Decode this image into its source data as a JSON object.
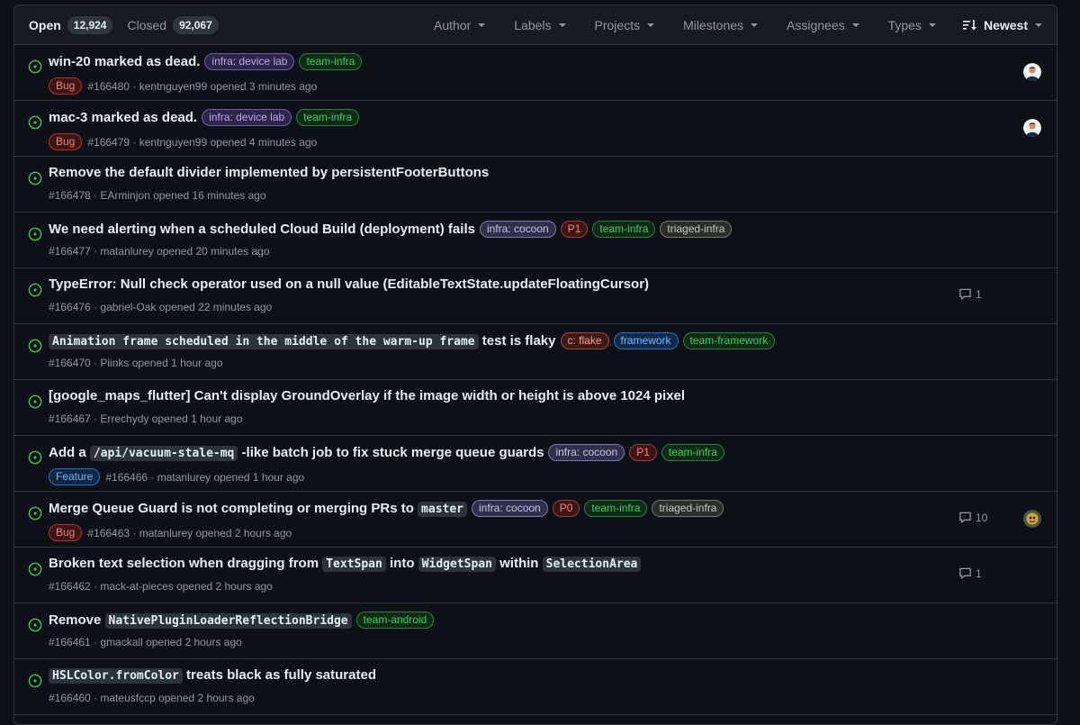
{
  "tabs": {
    "open_label": "Open",
    "open_count": "12,924",
    "closed_label": "Closed",
    "closed_count": "92,067"
  },
  "filters": [
    "Author",
    "Labels",
    "Projects",
    "Milestones",
    "Assignees",
    "Types"
  ],
  "sort_label": "Newest",
  "label_colors": {
    "infra: device lab": {
      "fg": "#b7a7f2",
      "bg": "#2e2647",
      "bd": "#6e5bb8"
    },
    "infra: cocoon": {
      "fg": "#c9c3ee",
      "bg": "#30304a",
      "bd": "#7c77b0"
    },
    "team-infra": {
      "fg": "#3fd15c",
      "bg": "#0f2a17",
      "bd": "#238636"
    },
    "team-framework": {
      "fg": "#3fd15c",
      "bg": "#0f2a17",
      "bd": "#238636"
    },
    "team-android": {
      "fg": "#3fd15c",
      "bg": "#0f2a17",
      "bd": "#238636"
    },
    "triaged-infra": {
      "fg": "#c2c8c2",
      "bg": "#2a2f2a",
      "bd": "#6f776f"
    },
    "P1": {
      "fg": "#ff8177",
      "bg": "#3b1615",
      "bd": "#a23a33"
    },
    "P0": {
      "fg": "#ff8177",
      "bg": "#3b1615",
      "bd": "#a23a33"
    },
    "Bug": {
      "fg": "#ff7b72",
      "bg": "#3b1615",
      "bd": "#b3322b"
    },
    "c: flake": {
      "fg": "#ff9e8c",
      "bg": "#3d1a15",
      "bd": "#a8483a"
    },
    "framework": {
      "fg": "#79b8ff",
      "bg": "#102a4a",
      "bd": "#2f6fbf"
    },
    "Feature": {
      "fg": "#6cb6ff",
      "bg": "#0f2744",
      "bd": "#2f6fbf"
    }
  },
  "issues": [
    {
      "title_parts": [
        {
          "t": "win-20 marked as dead."
        }
      ],
      "labels": [
        "infra: device lab",
        "team-infra"
      ],
      "type_label": "Bug",
      "number": "#166480",
      "byline": "kentnguyen99 opened 3 minutes ago",
      "comments": "",
      "avatar": "person"
    },
    {
      "title_parts": [
        {
          "t": "mac-3 marked as dead."
        }
      ],
      "labels": [
        "infra: device lab",
        "team-infra"
      ],
      "type_label": "Bug",
      "number": "#166479",
      "byline": "kentnguyen99 opened 4 minutes ago",
      "comments": "",
      "avatar": "person"
    },
    {
      "title_parts": [
        {
          "t": "Remove the default divider implemented by persistentFooterButtons"
        }
      ],
      "labels": [],
      "type_label": "",
      "number": "#166478",
      "byline": "EArminjon opened 16 minutes ago",
      "comments": "",
      "avatar": ""
    },
    {
      "title_parts": [
        {
          "t": "We need alerting when a scheduled Cloud Build (deployment) fails"
        }
      ],
      "labels": [
        "infra: cocoon",
        "P1",
        "team-infra",
        "triaged-infra"
      ],
      "type_label": "",
      "number": "#166477",
      "byline": "matanlurey opened 20 minutes ago",
      "comments": "",
      "avatar": ""
    },
    {
      "title_parts": [
        {
          "t": "TypeError: Null check operator used on a null value (EditableTextState.updateFloatingCursor)"
        }
      ],
      "labels": [],
      "type_label": "",
      "number": "#166476",
      "byline": "gabriel-Oak opened 22 minutes ago",
      "comments": "1",
      "avatar": ""
    },
    {
      "title_parts": [
        {
          "t": "Animation frame scheduled in the middle of the warm-up frame",
          "code": true
        },
        {
          "t": " test is flaky"
        }
      ],
      "labels": [
        "c: flake",
        "framework",
        "team-framework"
      ],
      "type_label": "",
      "number": "#166470",
      "byline": "Piinks opened 1 hour ago",
      "comments": "",
      "avatar": ""
    },
    {
      "title_parts": [
        {
          "t": "[google_maps_flutter] Can't display GroundOverlay if the image width or height is above 1024 pixel"
        }
      ],
      "labels": [],
      "type_label": "",
      "number": "#166467",
      "byline": "Errechydy opened 1 hour ago",
      "comments": "",
      "avatar": ""
    },
    {
      "title_parts": [
        {
          "t": "Add a "
        },
        {
          "t": "/api/vacuum-stale-mq",
          "code": true
        },
        {
          "t": " -like batch job to fix stuck merge queue guards"
        }
      ],
      "labels": [
        "infra: cocoon",
        "P1",
        "team-infra"
      ],
      "type_label": "Feature",
      "number": "#166466",
      "byline": "matanlurey opened 1 hour ago",
      "comments": "",
      "avatar": ""
    },
    {
      "title_parts": [
        {
          "t": "Merge Queue Guard is not completing or merging PRs to "
        },
        {
          "t": "master",
          "code": true
        }
      ],
      "labels": [
        "infra: cocoon",
        "P0",
        "team-infra",
        "triaged-infra"
      ],
      "type_label": "Bug",
      "number": "#166463",
      "byline": "matanlurey opened 2 hours ago",
      "comments": "10",
      "avatar": "bot"
    },
    {
      "title_parts": [
        {
          "t": "Broken text selection when dragging from "
        },
        {
          "t": "TextSpan",
          "code": true
        },
        {
          "t": " into "
        },
        {
          "t": "WidgetSpan",
          "code": true
        },
        {
          "t": " within "
        },
        {
          "t": "SelectionArea",
          "code": true
        }
      ],
      "labels": [],
      "type_label": "",
      "number": "#166462",
      "byline": "mack-at-pieces opened 2 hours ago",
      "comments": "1",
      "avatar": ""
    },
    {
      "title_parts": [
        {
          "t": "Remove "
        },
        {
          "t": "NativePluginLoaderReflectionBridge",
          "code": true
        }
      ],
      "labels": [
        "team-android"
      ],
      "type_label": "",
      "number": "#166461",
      "byline": "gmackall opened 2 hours ago",
      "comments": "",
      "avatar": ""
    },
    {
      "title_parts": [
        {
          "t": "HSLColor.fromColor",
          "code": true
        },
        {
          "t": " treats black as fully saturated"
        }
      ],
      "labels": [],
      "type_label": "",
      "number": "#166460",
      "byline": "mateusfccp opened 2 hours ago",
      "comments": "",
      "avatar": ""
    }
  ]
}
